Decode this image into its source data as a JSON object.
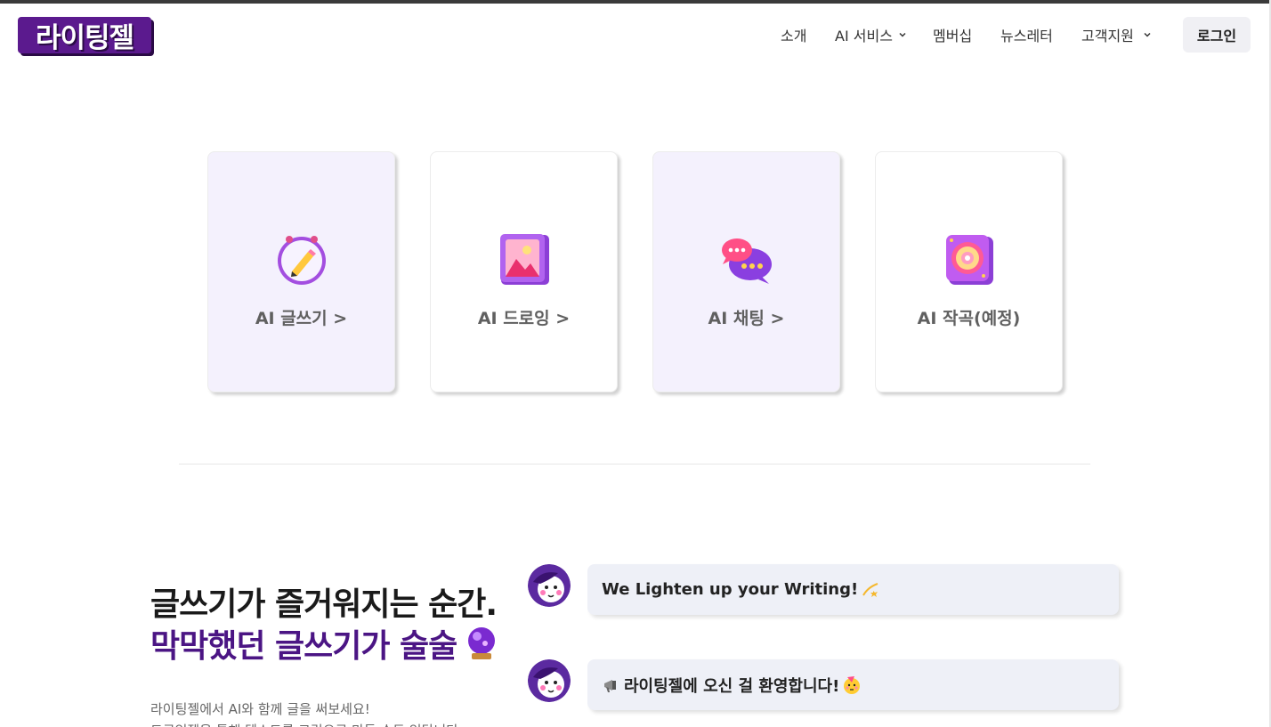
{
  "header": {
    "logo_text": "라이팅젤",
    "nav": [
      {
        "label": "소개",
        "has_dropdown": false
      },
      {
        "label": "AI 서비스",
        "has_dropdown": true
      },
      {
        "label": "멤버십",
        "has_dropdown": false
      },
      {
        "label": "뉴스레터",
        "has_dropdown": false
      },
      {
        "label": "고객지원",
        "has_dropdown": true
      }
    ],
    "login_label": "로그인"
  },
  "services": [
    {
      "label": "AI 글쓰기 >",
      "icon": "pencil-clock-icon",
      "bg": "#f4f1fd"
    },
    {
      "label": "AI 드로잉 >",
      "icon": "picture-frame-icon",
      "bg": "#ffffff"
    },
    {
      "label": "AI 채팅 >",
      "icon": "chat-bubbles-icon",
      "bg": "#f4f1fd"
    },
    {
      "label": "AI 작곡(예정)",
      "icon": "speaker-icon",
      "bg": "#ffffff"
    }
  ],
  "hero": {
    "line1": "글쓰기가 즐거워지는 순간.",
    "line2": "막막했던 글쓰기가 술술",
    "line2_icon": "crystal-ball-icon",
    "sub_lines": [
      "라이팅젤에서 AI와 함께 글을 써보세요!",
      "드로잉젤을 통해 텍스트를 그림으로 만들 수도 있답니다."
    ]
  },
  "chat": [
    {
      "text": "We Lighten up your Writing!",
      "trailing_icon": "dizzy-star-icon"
    },
    {
      "text": "라이팅젤에 오신 걸 환영합니다!",
      "leading_icon": "megaphone-icon",
      "trailing_icon": "party-face-icon"
    }
  ],
  "colors": {
    "brand_purple": "#4b1584",
    "logo_purple": "#5b1a8e",
    "card_tint": "#f4f1fd",
    "bubble_bg": "#eef0f7"
  }
}
